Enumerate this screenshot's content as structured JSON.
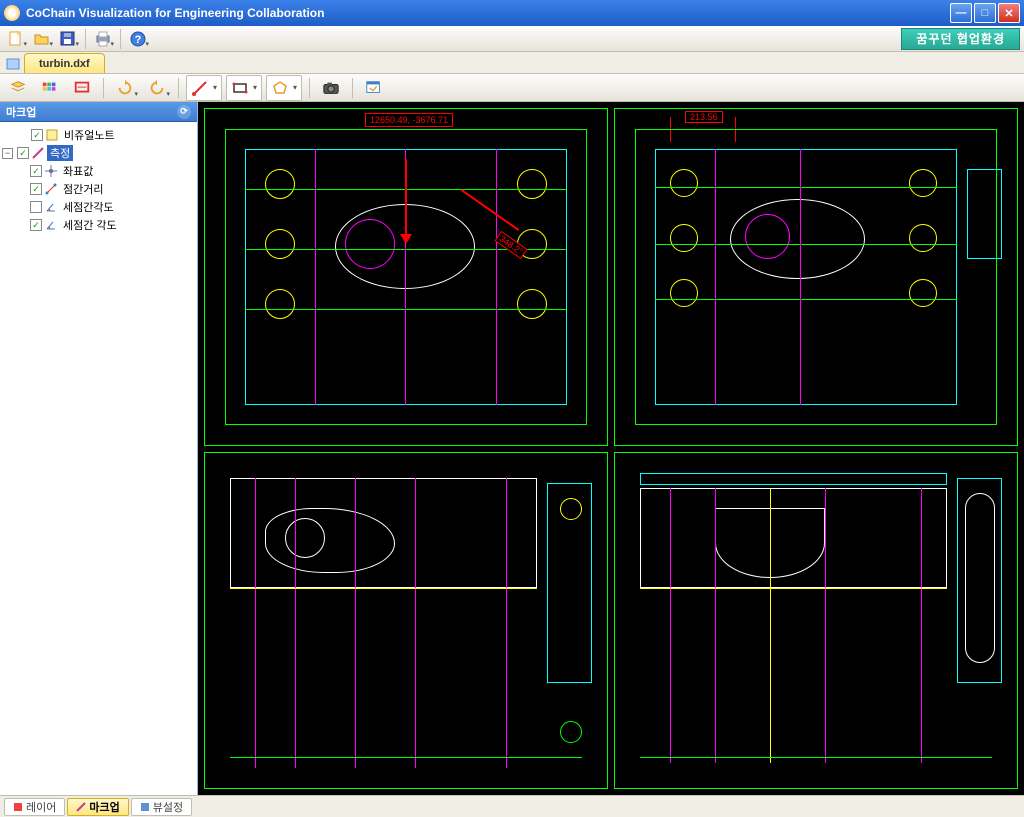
{
  "app": {
    "title": "CoChain Visualization for Engineering Collaboration",
    "brand_banner": "꿈꾸던 협업환경"
  },
  "file_tab": {
    "name": "turbin.dxf"
  },
  "side_panel": {
    "header": "마크업",
    "items": [
      {
        "label": "비쥬얼노트",
        "checked": true,
        "selected": false,
        "icon": "note"
      },
      {
        "label": "측정",
        "checked": true,
        "selected": true,
        "icon": "measure",
        "expandable": true
      },
      {
        "label": "좌표값",
        "checked": true,
        "selected": false,
        "icon": "coord"
      },
      {
        "label": "점간거리",
        "checked": true,
        "selected": false,
        "icon": "distance"
      },
      {
        "label": "세점간각도",
        "checked": false,
        "selected": false,
        "icon": "angle3"
      },
      {
        "label": "세점간 각도",
        "checked": true,
        "selected": false,
        "icon": "angle3b"
      }
    ]
  },
  "canvas": {
    "annotations": {
      "coord_label": "12650.49, -3676.71",
      "dim_label": "213.56",
      "angle_label": "348.2°"
    }
  },
  "bottom_tabs": {
    "items": [
      {
        "label": "레이어",
        "active": false
      },
      {
        "label": "마크업",
        "active": true
      },
      {
        "label": "뷰설정",
        "active": false
      }
    ]
  },
  "toolbar_main": {
    "icons": [
      "new-file",
      "open-folder",
      "save",
      "print",
      "help"
    ]
  },
  "toolbar_secondary": {
    "icons": [
      "layers",
      "palette",
      "redline",
      "rotate-cw",
      "rotate-ccw",
      "line-tool",
      "rect-tool",
      "polygon-tool",
      "camera",
      "measure-dialog"
    ]
  }
}
